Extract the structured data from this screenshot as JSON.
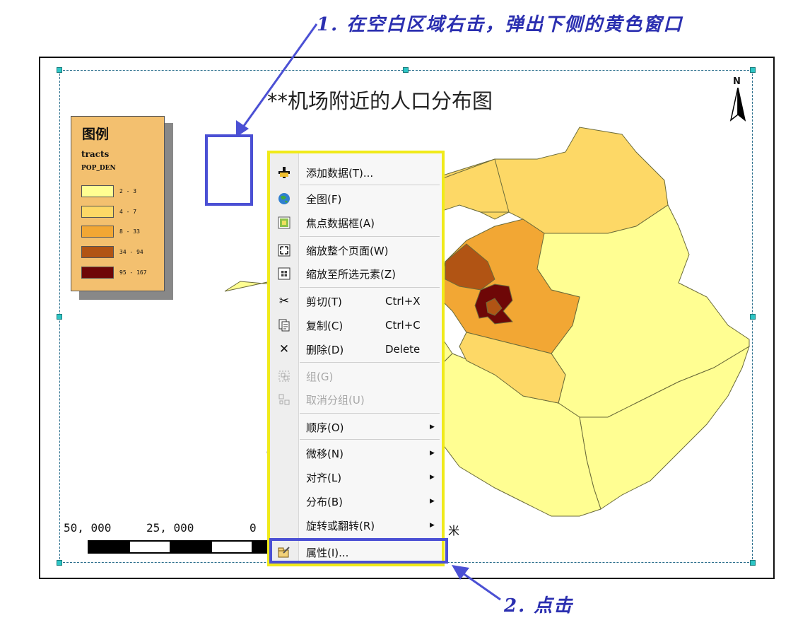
{
  "annotations": {
    "step1": "1. 在空白区域右击，弹出下侧的黄色窗口",
    "step2": "2. 点击"
  },
  "map": {
    "title": "**机场附近的人口分布图",
    "north_label": "N"
  },
  "legend": {
    "title": "图例",
    "layer": "tracts",
    "field": "POP_DEN",
    "classes": [
      {
        "label": "2 - 3",
        "color": "#fffe92"
      },
      {
        "label": "4 - 7",
        "color": "#fdd866"
      },
      {
        "label": "8 - 33",
        "color": "#f2a734"
      },
      {
        "label": "34 - 94",
        "color": "#b15414"
      },
      {
        "label": "95 - 167",
        "color": "#6e0707"
      }
    ]
  },
  "scalebar": {
    "labels": [
      "50, 000",
      "25, 000",
      "0"
    ],
    "unit": "米"
  },
  "context_menu": {
    "items": [
      {
        "icon": "add-data-icon",
        "label": "添加数据(T)...",
        "shortcut": "",
        "submenu": false,
        "enabled": true
      },
      {
        "icon": "full-extent-globe-icon",
        "label": "全图(F)",
        "shortcut": "",
        "submenu": false,
        "enabled": true
      },
      {
        "icon": "focus-data-frame-icon",
        "label": "焦点数据框(A)",
        "shortcut": "",
        "submenu": false,
        "enabled": true
      },
      {
        "icon": "zoom-whole-page-icon",
        "label": "缩放整个页面(W)",
        "shortcut": "",
        "submenu": false,
        "enabled": true
      },
      {
        "icon": "zoom-selected-elements-icon",
        "label": "缩放至所选元素(Z)",
        "shortcut": "",
        "submenu": false,
        "enabled": true
      },
      {
        "icon": "scissors-icon",
        "label": "剪切(T)",
        "shortcut": "Ctrl+X",
        "submenu": false,
        "enabled": true
      },
      {
        "icon": "copy-icon",
        "label": "复制(C)",
        "shortcut": "Ctrl+C",
        "submenu": false,
        "enabled": true
      },
      {
        "icon": "delete-x-icon",
        "label": "删除(D)",
        "shortcut": "Delete",
        "submenu": false,
        "enabled": true
      },
      {
        "icon": "group-icon",
        "label": "组(G)",
        "shortcut": "",
        "submenu": false,
        "enabled": false
      },
      {
        "icon": "ungroup-icon",
        "label": "取消分组(U)",
        "shortcut": "",
        "submenu": false,
        "enabled": false
      },
      {
        "icon": "",
        "label": "顺序(O)",
        "shortcut": "",
        "submenu": true,
        "enabled": true
      },
      {
        "icon": "",
        "label": "微移(N)",
        "shortcut": "",
        "submenu": true,
        "enabled": true
      },
      {
        "icon": "",
        "label": "对齐(L)",
        "shortcut": "",
        "submenu": true,
        "enabled": true
      },
      {
        "icon": "",
        "label": "分布(B)",
        "shortcut": "",
        "submenu": true,
        "enabled": true
      },
      {
        "icon": "",
        "label": "旋转或翻转(R)",
        "shortcut": "",
        "submenu": true,
        "enabled": true
      },
      {
        "icon": "properties-icon",
        "label": "属性(I)...",
        "shortcut": "",
        "submenu": false,
        "enabled": true
      }
    ]
  },
  "colors": {
    "annotation_blue": "#2b2fb0",
    "menu_border_yellow": "#f0ea1a",
    "highlight_blue": "#4b50d4"
  }
}
